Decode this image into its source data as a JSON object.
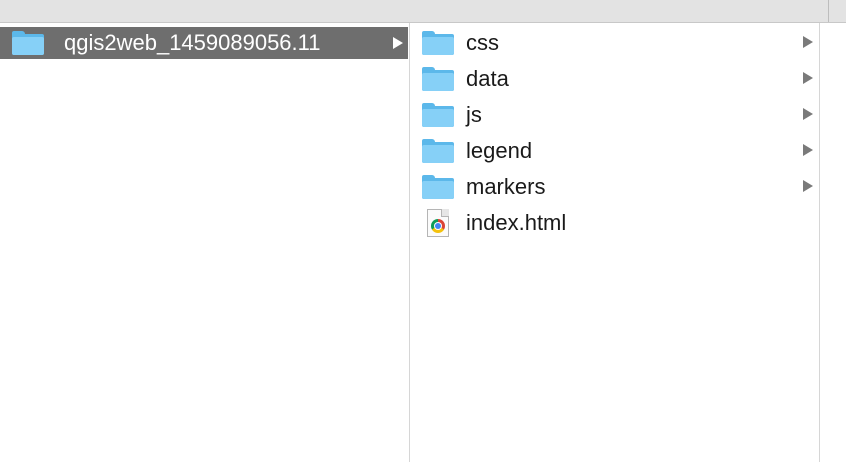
{
  "column1": {
    "items": [
      {
        "label": "qgis2web_1459089056.11",
        "icon": "folder-icon",
        "selected": true,
        "has_children": true
      }
    ]
  },
  "column2": {
    "items": [
      {
        "label": "css",
        "icon": "folder-icon",
        "has_children": true
      },
      {
        "label": "data",
        "icon": "folder-icon",
        "has_children": true
      },
      {
        "label": "js",
        "icon": "folder-icon",
        "has_children": true
      },
      {
        "label": "legend",
        "icon": "folder-icon",
        "has_children": true
      },
      {
        "label": "markers",
        "icon": "folder-icon",
        "has_children": true
      },
      {
        "label": "index.html",
        "icon": "chrome-html-file-icon",
        "has_children": false
      }
    ]
  },
  "colors": {
    "selection": "#6e6e6e",
    "folder": "#86d0f7",
    "folder_dark": "#5cb8ea",
    "chevron": "#7a7a7a"
  }
}
